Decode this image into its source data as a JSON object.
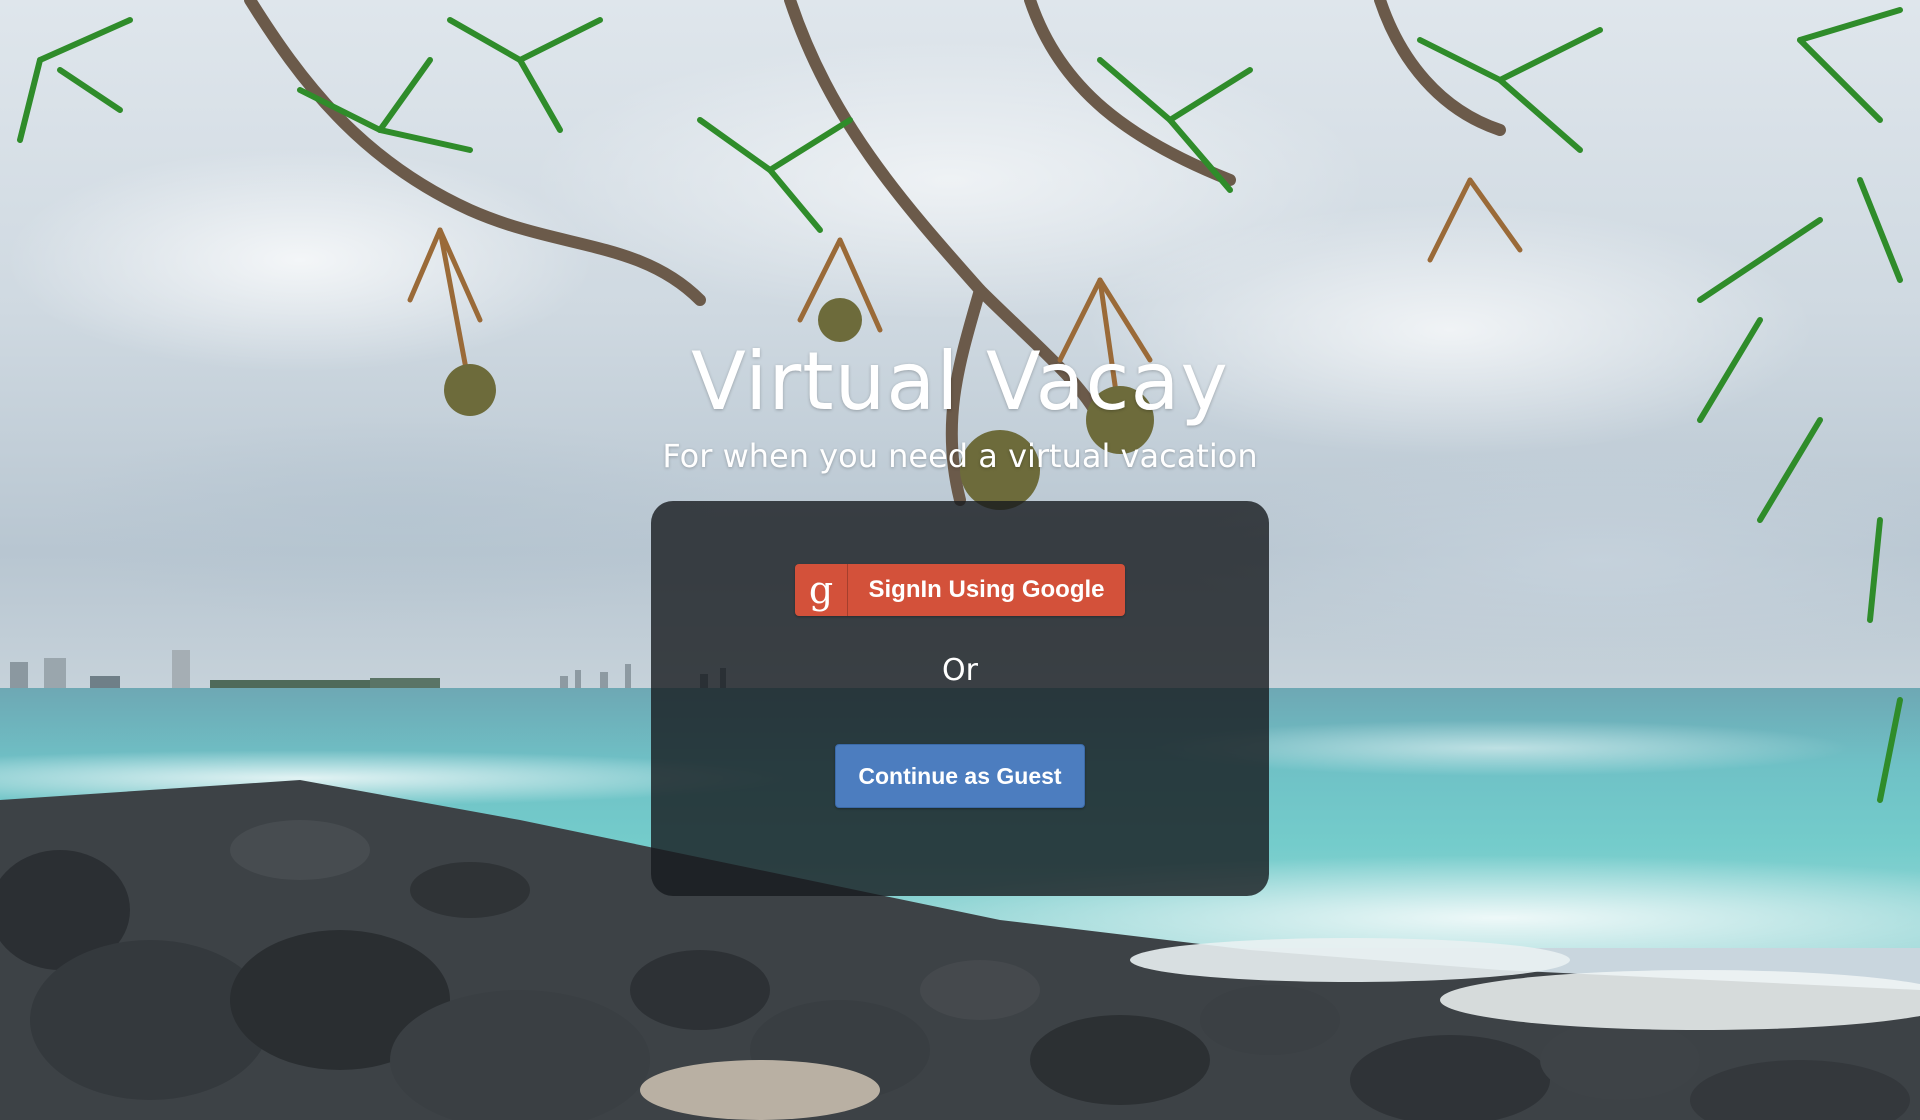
{
  "app": {
    "title": "Virtual Vacay",
    "tagline": "For when you need a virtual vacation"
  },
  "login_card": {
    "google_button": {
      "icon": "google-g-icon",
      "icon_glyph": "g",
      "label": "SignIn Using Google",
      "color": "#d3513a"
    },
    "separator": "Or",
    "guest_button": {
      "label": "Continue as Guest",
      "color": "#4c7dbf"
    }
  },
  "background": {
    "description_icon": "tropical-beach-background"
  }
}
